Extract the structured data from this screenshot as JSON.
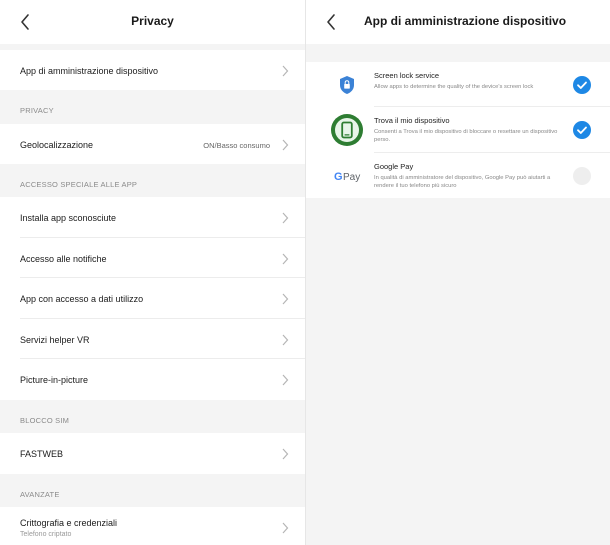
{
  "left": {
    "title": "Privacy",
    "rows": {
      "admin_apps": {
        "label": "App di amministrazione dispositivo"
      },
      "location": {
        "label": "Geolocalizzazione",
        "value": "ON/Basso consumo"
      },
      "unknown_apps": {
        "label": "Installa app sconosciute"
      },
      "notification_access": {
        "label": "Accesso alle notifiche"
      },
      "usage_access": {
        "label": "App con accesso a dati utilizzo"
      },
      "vr_helper": {
        "label": "Servizi helper VR"
      },
      "pip": {
        "label": "Picture-in-picture"
      },
      "fastweb": {
        "label": "FASTWEB"
      },
      "encryption": {
        "label": "Crittografia e credenziali",
        "sub": "Telefono criptato"
      }
    },
    "sections": {
      "privacy": "PRIVACY",
      "special_access": "ACCESSO SPECIALE ALLE APP",
      "sim_lock": "BLOCCO SIM",
      "advanced": "AVANZATE"
    }
  },
  "right": {
    "title": "App di amministrazione dispositivo",
    "admins": [
      {
        "name": "Screen lock service",
        "desc": "Allow apps to determine the quality of the device's screen lock",
        "enabled": true,
        "icon": "shield-lock-icon"
      },
      {
        "name": "Trova il mio dispositivo",
        "desc": "Consenti a Trova il mio dispositivo di bloccare o resettare un dispositivo perso.",
        "enabled": true,
        "icon": "find-my-device-icon"
      },
      {
        "name": "Google Pay",
        "desc": "In qualità di amministratore del dispositivo, Google Pay può aiutarti a rendere il tuo telefono più sicuro",
        "enabled": false,
        "icon": "google-pay-logo",
        "logo_text": "G Pay"
      }
    ]
  },
  "colors": {
    "accent": "#1e88e5",
    "background": "#f4f4f4",
    "find_green": "#2e7d32"
  }
}
